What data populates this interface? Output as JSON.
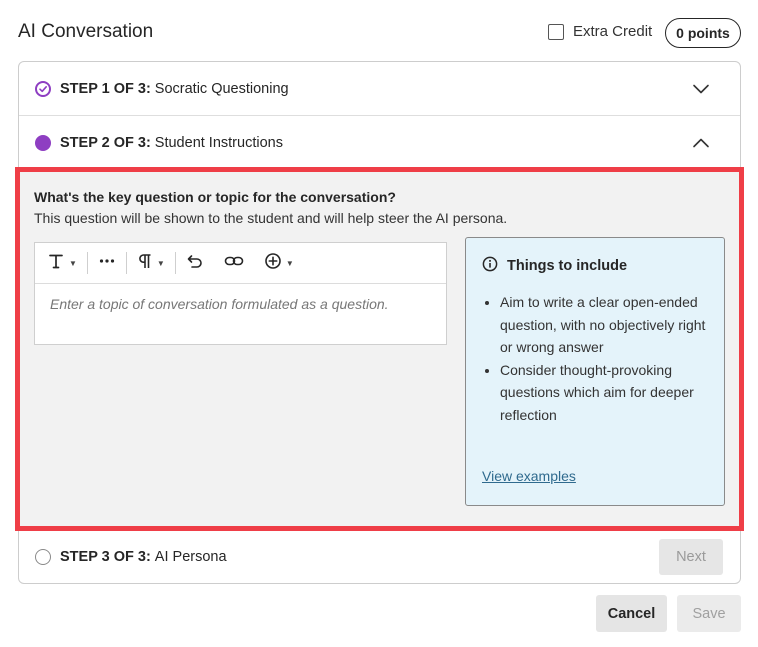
{
  "header": {
    "title": "AI Conversation",
    "extra_credit_label": "Extra Credit",
    "extra_credit_checked": false,
    "points": "0 points"
  },
  "steps": [
    {
      "number": "STEP 1 OF 3:",
      "title": "Socratic Questioning",
      "status": "complete",
      "expanded": false
    },
    {
      "number": "STEP 2 OF 3:",
      "title": "Student Instructions",
      "status": "current",
      "expanded": true
    },
    {
      "number": "STEP 3 OF 3:",
      "title": "AI Persona",
      "status": "not-started",
      "expanded": false
    }
  ],
  "panel": {
    "heading": "What's the key question or topic for the conversation?",
    "subtext": "This question will be shown to the student and will help steer the AI persona.",
    "editor_placeholder": "Enter a topic of conversation formulated as a question.",
    "toolbar_icons": [
      "text-format-icon",
      "more-icon",
      "paragraph-icon",
      "undo-icon",
      "link-icon",
      "insert-icon"
    ]
  },
  "tips": {
    "title": "Things to include",
    "items": [
      "Aim to write a clear open-ended question, with no objectively right or wrong answer",
      "Consider thought-provoking questions which aim for deeper reflection"
    ],
    "link": "View examples"
  },
  "buttons": {
    "next": "Next",
    "cancel": "Cancel",
    "save": "Save"
  },
  "colors": {
    "accent_purple": "#8e3ec2",
    "highlight_red": "#ef3e47",
    "tips_bg": "#e4f3fa",
    "link_blue": "#2f6a8e"
  }
}
